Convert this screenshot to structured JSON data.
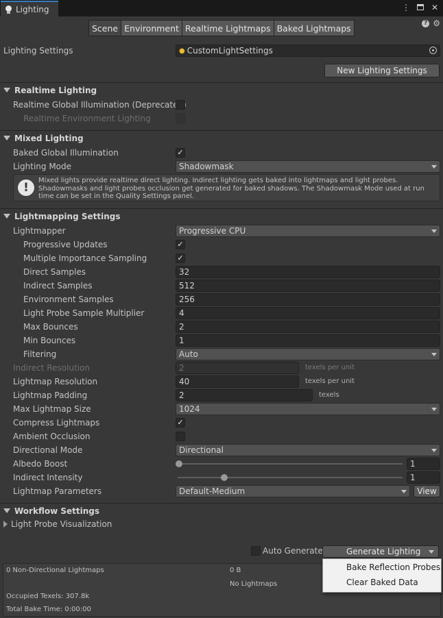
{
  "window": {
    "tab_title": "Lighting",
    "icons": [
      "more-options-icon",
      "maximize-icon",
      "close-icon"
    ]
  },
  "tabs": [
    {
      "label": "Scene",
      "active": true
    },
    {
      "label": "Environment",
      "active": false
    },
    {
      "label": "Realtime Lightmaps",
      "active": false
    },
    {
      "label": "Baked Lightmaps",
      "active": false
    }
  ],
  "lighting_settings": {
    "label": "Lighting Settings",
    "asset": "CustomLightSettings",
    "new_button": "New Lighting Settings"
  },
  "realtime": {
    "header": "Realtime Lighting",
    "gi_label": "Realtime Global Illumination (Deprecated)",
    "gi_checked": false,
    "env_label": "Realtime Environment Lighting",
    "env_checked": false
  },
  "mixed": {
    "header": "Mixed Lighting",
    "baked_gi_label": "Baked Global Illumination",
    "baked_gi_checked": true,
    "mode_label": "Lighting Mode",
    "mode_value": "Shadowmask",
    "help_text": "Mixed lights provide realtime direct lighting. Indirect lighting gets baked into lightmaps and light probes. Shadowmasks and light probes occlusion get generated for baked shadows. The Shadowmask Mode used at run time can be set in the Quality Settings panel."
  },
  "lightmapping": {
    "header": "Lightmapping Settings",
    "lightmapper_label": "Lightmapper",
    "lightmapper_value": "Progressive CPU",
    "progressive_updates_label": "Progressive Updates",
    "progressive_updates_checked": true,
    "mis_label": "Multiple Importance Sampling",
    "mis_checked": true,
    "direct_samples_label": "Direct Samples",
    "direct_samples": "32",
    "indirect_samples_label": "Indirect Samples",
    "indirect_samples": "512",
    "env_samples_label": "Environment Samples",
    "env_samples": "256",
    "probe_mult_label": "Light Probe Sample Multiplier",
    "probe_mult": "4",
    "max_bounces_label": "Max Bounces",
    "max_bounces": "2",
    "min_bounces_label": "Min Bounces",
    "min_bounces": "1",
    "filtering_label": "Filtering",
    "filtering_value": "Auto",
    "indirect_res_label": "Indirect Resolution",
    "indirect_res": "2",
    "texels_per_unit": "texels per unit",
    "lightmap_res_label": "Lightmap Resolution",
    "lightmap_res": "40",
    "padding_label": "Lightmap Padding",
    "padding": "2",
    "texels": "texels",
    "max_size_label": "Max Lightmap Size",
    "max_size_value": "1024",
    "compress_label": "Compress Lightmaps",
    "compress_checked": true,
    "ao_label": "Ambient Occlusion",
    "ao_checked": false,
    "dir_mode_label": "Directional Mode",
    "dir_mode_value": "Directional",
    "albedo_label": "Albedo Boost",
    "albedo_value": "1",
    "albedo_fraction": 0.0,
    "indirect_int_label": "Indirect Intensity",
    "indirect_int_value": "1",
    "indirect_int_fraction": 0.2,
    "params_label": "Lightmap Parameters",
    "params_value": "Default-Medium",
    "view_button": "View"
  },
  "workflow": {
    "header": "Workflow Settings",
    "probe_vis_label": "Light Probe Visualization"
  },
  "bake": {
    "auto_generate_label": "Auto Generate",
    "auto_generate_checked": false,
    "generate_button": "Generate Lighting",
    "menu": [
      "Bake Reflection Probes",
      "Clear Baked Data"
    ]
  },
  "stats": {
    "lightmaps": "0 Non-Directional Lightmaps",
    "size": "0 B",
    "no_lightmaps": "No Lightmaps",
    "occupied": "Occupied Texels: 307.8k",
    "bake_time": "Total Bake Time: 0:00:00"
  }
}
